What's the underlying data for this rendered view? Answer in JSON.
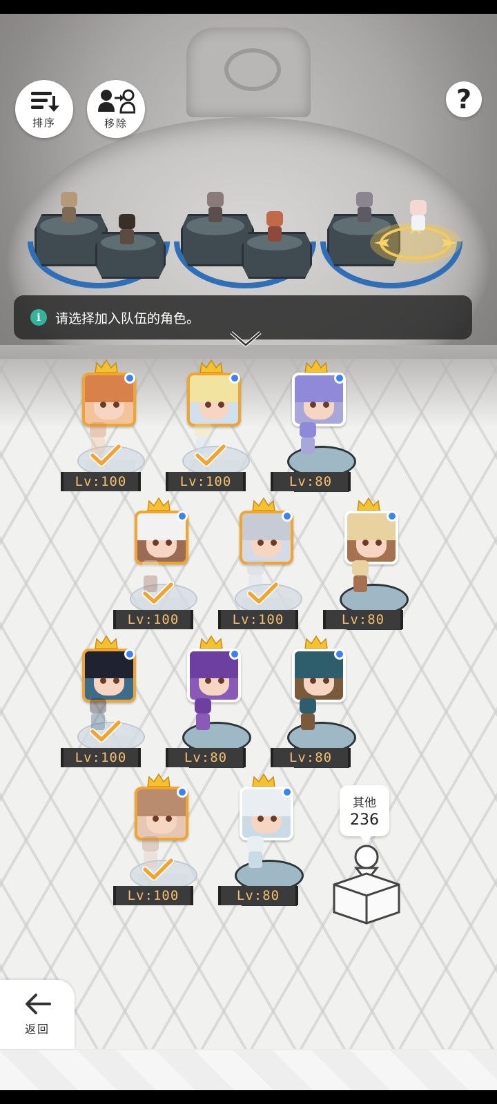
{
  "toolbar": {
    "sort_label": "排序",
    "remove_label": "移除",
    "help_label": "?"
  },
  "banner": {
    "text": "请选择加入队伍的角色。"
  },
  "characters": [
    {
      "level": "Lv:100",
      "selected": true,
      "portrait_bg": "#f3c49b",
      "hair": "#d9814a"
    },
    {
      "level": "Lv:100",
      "selected": true,
      "portrait_bg": "#cfe0f0",
      "hair": "#f3e3a1"
    },
    {
      "level": "Lv:80",
      "selected": false,
      "portrait_bg": "#a9a6d9",
      "hair": "#8e89d8"
    },
    {
      "level": "Lv:100",
      "selected": true,
      "portrait_bg": "#9a6b55",
      "hair": "#f2f2f2"
    },
    {
      "level": "Lv:100",
      "selected": true,
      "portrait_bg": "#d4dbe8",
      "hair": "#c7cbd6"
    },
    {
      "level": "Lv:80",
      "selected": false,
      "portrait_bg": "#a6714f",
      "hair": "#e8d2a0"
    },
    {
      "level": "Lv:100",
      "selected": true,
      "portrait_bg": "#3d6b8a",
      "hair": "#1f2230"
    },
    {
      "level": "Lv:80",
      "selected": false,
      "portrait_bg": "#8a5ab8",
      "hair": "#6d3fa0"
    },
    {
      "level": "Lv:80",
      "selected": false,
      "portrait_bg": "#7a5a3a",
      "hair": "#2e5e6b"
    },
    {
      "level": "Lv:100",
      "selected": true,
      "portrait_bg": "#e6c7b5",
      "hair": "#b98c6e"
    },
    {
      "level": "Lv:80",
      "selected": false,
      "portrait_bg": "#c9dbe6",
      "hair": "#e9eef3"
    }
  ],
  "others": {
    "label": "其他",
    "count": "236"
  },
  "nav": {
    "back_label": "返回"
  },
  "colors": {
    "accent_orange": "#f0a530",
    "crown_gold": "#f5c12e",
    "info_green": "#35b39a",
    "team_ring_blue": "#2f6fb8",
    "level_text": "#f3c073"
  }
}
